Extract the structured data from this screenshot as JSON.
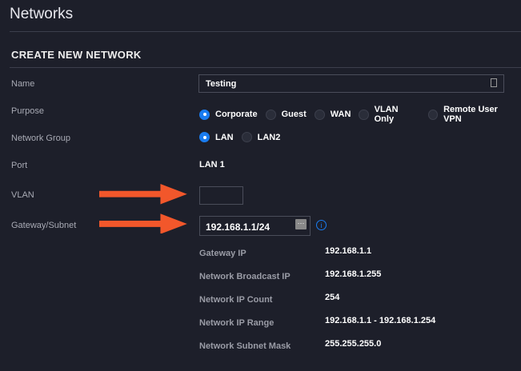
{
  "page": {
    "title": "Networks",
    "section": "CREATE NEW NETWORK"
  },
  "form": {
    "name": {
      "label": "Name",
      "value": "Testing"
    },
    "purpose": {
      "label": "Purpose",
      "options": [
        "Corporate",
        "Guest",
        "WAN",
        "VLAN Only",
        "Remote User VPN"
      ],
      "selected": "Corporate"
    },
    "network_group": {
      "label": "Network Group",
      "options": [
        "LAN",
        "LAN2"
      ],
      "selected": "LAN"
    },
    "port": {
      "label": "Port",
      "value": "LAN 1"
    },
    "vlan": {
      "label": "VLAN",
      "value": ""
    },
    "gateway": {
      "label": "Gateway/Subnet",
      "value": "192.168.1.1/24"
    }
  },
  "details": [
    {
      "label": "Gateway IP",
      "value": "192.168.1.1"
    },
    {
      "label": "Network Broadcast IP",
      "value": "192.168.1.255"
    },
    {
      "label": "Network IP Count",
      "value": "254"
    },
    {
      "label": "Network IP Range",
      "value": "192.168.1.1 - 192.168.1.254"
    },
    {
      "label": "Network Subnet Mask",
      "value": "255.255.255.0"
    }
  ],
  "colors": {
    "accent": "#1a7cf0",
    "arrow": "#f2572b"
  }
}
